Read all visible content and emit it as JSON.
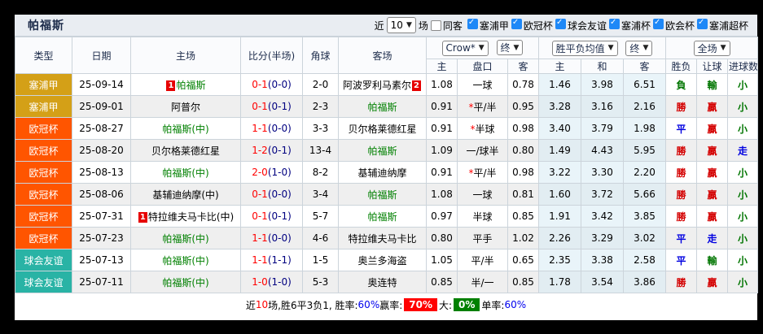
{
  "topbar": {
    "title": "帕福斯",
    "near": "近",
    "count": "10",
    "matches": "场",
    "same_away": "同客",
    "league_filters": [
      "塞浦甲",
      "欧冠杯",
      "球会友谊",
      "塞浦杯",
      "欧会杯",
      "塞浦超杯"
    ]
  },
  "header": {
    "type": "类型",
    "date": "日期",
    "home": "主场",
    "score": "比分(半场)",
    "corner": "角球",
    "away": "客场",
    "odds_select": "Crow*",
    "odds_final": "终",
    "odds_cols": [
      "主",
      "盘口",
      "客"
    ],
    "avg_select": "胜平负均值",
    "avg_final": "终",
    "avg_cols": [
      "主",
      "和",
      "客"
    ],
    "scope_select": "全场",
    "result_cols": [
      "胜负",
      "让球",
      "进球数"
    ]
  },
  "league_colors": {
    "塞浦甲": "#D4A017",
    "欧冠杯": "#FF5500",
    "球会友谊": "#29B3A5"
  },
  "result_colors": {
    "red": "#D40000",
    "green": "#007500",
    "blue": "#0000E0"
  },
  "rows": [
    {
      "league": "塞浦甲",
      "date": "25-09-14",
      "home": {
        "name": "帕福斯",
        "pafos": true,
        "badge_before": "1"
      },
      "away": {
        "name": "阿波罗利马素尔",
        "pafos": false,
        "badge_after": "2"
      },
      "score_ft": "0-1",
      "score_ht": "(0-0)",
      "corner": "2-0",
      "odds": [
        "1.08",
        "一球",
        "0.78"
      ],
      "star": false,
      "avg": [
        "1.46",
        "3.98",
        "6.51"
      ],
      "results": [
        [
          "負",
          "green"
        ],
        [
          "輸",
          "green"
        ],
        [
          "小",
          "green"
        ]
      ]
    },
    {
      "league": "塞浦甲",
      "date": "25-09-01",
      "home": {
        "name": "阿普尔",
        "pafos": false
      },
      "away": {
        "name": "帕福斯",
        "pafos": true
      },
      "score_ft": "0-1",
      "score_ht": "(0-1)",
      "corner": "2-3",
      "odds": [
        "0.91",
        "平/半",
        "0.95"
      ],
      "star": true,
      "avg": [
        "3.28",
        "3.16",
        "2.16"
      ],
      "results": [
        [
          "勝",
          "red"
        ],
        [
          "贏",
          "red"
        ],
        [
          "小",
          "green"
        ]
      ]
    },
    {
      "league": "欧冠杯",
      "date": "25-08-27",
      "home": {
        "name": "帕福斯(中)",
        "pafos": true
      },
      "away": {
        "name": "贝尔格莱德红星",
        "pafos": false
      },
      "score_ft": "1-1",
      "score_ht": "(0-0)",
      "corner": "3-3",
      "odds": [
        "0.91",
        "半球",
        "0.98"
      ],
      "star": true,
      "avg": [
        "3.40",
        "3.79",
        "1.98"
      ],
      "results": [
        [
          "平",
          "blue"
        ],
        [
          "贏",
          "red"
        ],
        [
          "小",
          "green"
        ]
      ]
    },
    {
      "league": "欧冠杯",
      "date": "25-08-20",
      "home": {
        "name": "贝尔格莱德红星",
        "pafos": false
      },
      "away": {
        "name": "帕福斯",
        "pafos": true
      },
      "score_ft": "1-2",
      "score_ht": "(0-1)",
      "corner": "13-4",
      "odds": [
        "1.09",
        "一/球半",
        "0.80"
      ],
      "star": false,
      "avg": [
        "1.49",
        "4.43",
        "5.95"
      ],
      "results": [
        [
          "勝",
          "red"
        ],
        [
          "贏",
          "red"
        ],
        [
          "走",
          "blue"
        ]
      ]
    },
    {
      "league": "欧冠杯",
      "date": "25-08-13",
      "home": {
        "name": "帕福斯(中)",
        "pafos": true
      },
      "away": {
        "name": "基辅迪纳摩",
        "pafos": false
      },
      "score_ft": "2-0",
      "score_ht": "(1-0)",
      "corner": "8-2",
      "odds": [
        "0.91",
        "平/半",
        "0.98"
      ],
      "star": true,
      "avg": [
        "3.22",
        "3.30",
        "2.20"
      ],
      "results": [
        [
          "勝",
          "red"
        ],
        [
          "贏",
          "red"
        ],
        [
          "小",
          "green"
        ]
      ]
    },
    {
      "league": "欧冠杯",
      "date": "25-08-06",
      "home": {
        "name": "基辅迪纳摩(中)",
        "pafos": false
      },
      "away": {
        "name": "帕福斯",
        "pafos": true
      },
      "score_ft": "0-1",
      "score_ht": "(0-0)",
      "corner": "3-4",
      "odds": [
        "1.08",
        "一球",
        "0.81"
      ],
      "star": false,
      "avg": [
        "1.60",
        "3.72",
        "5.66"
      ],
      "results": [
        [
          "勝",
          "red"
        ],
        [
          "贏",
          "red"
        ],
        [
          "小",
          "green"
        ]
      ]
    },
    {
      "league": "欧冠杯",
      "date": "25-07-31",
      "home": {
        "name": "特拉维夫马卡比(中)",
        "pafos": false,
        "badge_before": "1"
      },
      "away": {
        "name": "帕福斯",
        "pafos": true
      },
      "score_ft": "0-1",
      "score_ht": "(0-1)",
      "corner": "5-7",
      "odds": [
        "0.97",
        "半球",
        "0.85"
      ],
      "star": false,
      "avg": [
        "1.91",
        "3.42",
        "3.85"
      ],
      "results": [
        [
          "勝",
          "red"
        ],
        [
          "贏",
          "red"
        ],
        [
          "小",
          "green"
        ]
      ]
    },
    {
      "league": "欧冠杯",
      "date": "25-07-23",
      "home": {
        "name": "帕福斯(中)",
        "pafos": true
      },
      "away": {
        "name": "特拉维夫马卡比",
        "pafos": false
      },
      "score_ft": "1-1",
      "score_ht": "(0-0)",
      "corner": "4-6",
      "odds": [
        "0.80",
        "平手",
        "1.02"
      ],
      "star": false,
      "avg": [
        "2.26",
        "3.29",
        "3.02"
      ],
      "results": [
        [
          "平",
          "blue"
        ],
        [
          "走",
          "blue"
        ],
        [
          "小",
          "green"
        ]
      ]
    },
    {
      "league": "球会友谊",
      "date": "25-07-13",
      "home": {
        "name": "帕福斯(中)",
        "pafos": true
      },
      "away": {
        "name": "奥兰多海盗",
        "pafos": false
      },
      "score_ft": "1-1",
      "score_ht": "(1-1)",
      "corner": "1-5",
      "odds": [
        "1.05",
        "平/半",
        "0.65"
      ],
      "star": false,
      "avg": [
        "2.35",
        "3.38",
        "2.58"
      ],
      "results": [
        [
          "平",
          "blue"
        ],
        [
          "輸",
          "green"
        ],
        [
          "小",
          "green"
        ]
      ]
    },
    {
      "league": "球会友谊",
      "date": "25-07-11",
      "home": {
        "name": "帕福斯(中)",
        "pafos": true
      },
      "away": {
        "name": "奥连特",
        "pafos": false
      },
      "score_ft": "1-0",
      "score_ht": "(1-0)",
      "corner": "5-3",
      "odds": [
        "0.85",
        "半/一",
        "0.85"
      ],
      "star": false,
      "avg": [
        "1.78",
        "3.54",
        "3.86"
      ],
      "results": [
        [
          "勝",
          "red"
        ],
        [
          "贏",
          "red"
        ],
        [
          "小",
          "green"
        ]
      ]
    }
  ],
  "summary": {
    "parts": [
      {
        "text": "近",
        "style": "plain"
      },
      {
        "text": "10",
        "style": "red"
      },
      {
        "text": "场,胜6平3负1, 胜率:",
        "style": "plain"
      },
      {
        "text": "60%",
        "style": "blue"
      },
      {
        "text": " 赢率:",
        "style": "plain"
      },
      {
        "text": "70%",
        "style": "pill",
        "bg": "#ff0000"
      },
      {
        "text": " 大:",
        "style": "plain"
      },
      {
        "text": "0%",
        "style": "pill",
        "bg": "#008000"
      },
      {
        "text": " 单率:",
        "style": "plain"
      },
      {
        "text": "60%",
        "style": "blue"
      }
    ]
  }
}
